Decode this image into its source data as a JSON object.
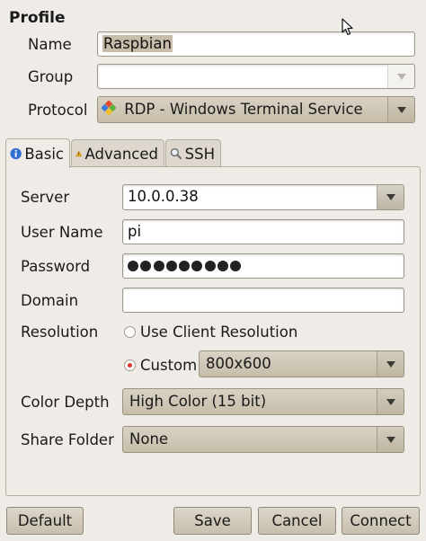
{
  "profile": {
    "section_title": "Profile",
    "name_label": "Name",
    "name_value": "Raspbian",
    "group_label": "Group",
    "group_value": "",
    "protocol_label": "Protocol",
    "protocol_value": "RDP - Windows Terminal Service"
  },
  "tabs": [
    {
      "label": "Basic",
      "icon": "info-icon",
      "active": true
    },
    {
      "label": "Advanced",
      "icon": "warning-icon",
      "active": false
    },
    {
      "label": "SSH",
      "icon": "magnifier-icon",
      "active": false
    }
  ],
  "basic": {
    "server_label": "Server",
    "server_value": "10.0.0.38",
    "username_label": "User Name",
    "username_value": "pi",
    "password_label": "Password",
    "password_length": 9,
    "domain_label": "Domain",
    "domain_value": "",
    "resolution_label": "Resolution",
    "resolution_client_label": "Use Client Resolution",
    "resolution_custom_label": "Custom",
    "resolution_selected": "custom",
    "resolution_value": "800x600",
    "color_depth_label": "Color Depth",
    "color_depth_value": "High Color (15 bit)",
    "share_folder_label": "Share Folder",
    "share_folder_value": "None"
  },
  "buttons": {
    "default": "Default",
    "save": "Save",
    "cancel": "Cancel",
    "connect": "Connect"
  },
  "colors": {
    "window_bg": "#efebe7",
    "selection": "#c7bda9",
    "radio_active": "#e0372a"
  }
}
